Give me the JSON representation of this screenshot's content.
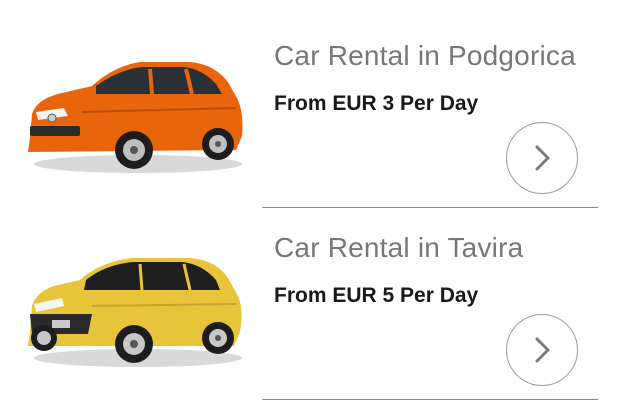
{
  "listings": [
    {
      "title": "Car Rental in Podgorica",
      "price": "From EUR 3 Per Day",
      "car_color": "#e8650c",
      "icon": "chevron-right-icon"
    },
    {
      "title": "Car Rental in Tavira",
      "price": "From EUR 5 Per Day",
      "car_color": "#e7c43a",
      "icon": "chevron-right-icon"
    }
  ]
}
